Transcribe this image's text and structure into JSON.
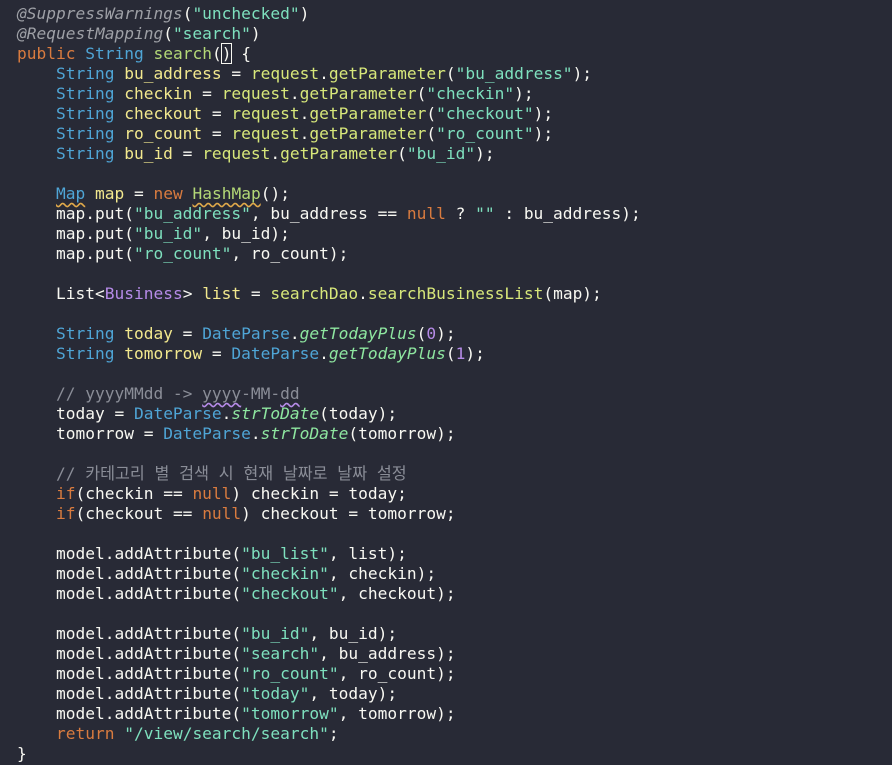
{
  "editor": {
    "lines": [
      [
        {
          "t": "@SuppressWarnings",
          "c": "ann"
        },
        {
          "t": "(",
          "c": "plain"
        },
        {
          "t": "\"unchecked\"",
          "c": "str"
        },
        {
          "t": ")",
          "c": "plain"
        }
      ],
      [
        {
          "t": "@RequestMapping",
          "c": "ann"
        },
        {
          "t": "(",
          "c": "plain"
        },
        {
          "t": "\"search\"",
          "c": "str"
        },
        {
          "t": ")",
          "c": "plain"
        }
      ],
      [
        {
          "t": "public ",
          "c": "kw"
        },
        {
          "t": "String ",
          "c": "ty"
        },
        {
          "t": "search",
          "c": "cls"
        },
        {
          "t": "(",
          "c": "plain"
        },
        {
          "t": ")",
          "c": "plain caret-box"
        },
        {
          "t": " {",
          "c": "plain"
        }
      ],
      [
        {
          "t": "    String ",
          "c": "ty"
        },
        {
          "t": "bu_address",
          "c": "var"
        },
        {
          "t": " = ",
          "c": "plain"
        },
        {
          "t": "request",
          "c": "obj"
        },
        {
          "t": ".",
          "c": "plain"
        },
        {
          "t": "getParameter",
          "c": "meth"
        },
        {
          "t": "(",
          "c": "plain"
        },
        {
          "t": "\"bu_address\"",
          "c": "str"
        },
        {
          "t": ");",
          "c": "plain"
        }
      ],
      [
        {
          "t": "    String ",
          "c": "ty"
        },
        {
          "t": "checkin",
          "c": "var"
        },
        {
          "t": " = ",
          "c": "plain"
        },
        {
          "t": "request",
          "c": "obj"
        },
        {
          "t": ".",
          "c": "plain"
        },
        {
          "t": "getParameter",
          "c": "meth"
        },
        {
          "t": "(",
          "c": "plain"
        },
        {
          "t": "\"checkin\"",
          "c": "str"
        },
        {
          "t": ");",
          "c": "plain"
        }
      ],
      [
        {
          "t": "    String ",
          "c": "ty"
        },
        {
          "t": "checkout",
          "c": "var"
        },
        {
          "t": " = ",
          "c": "plain"
        },
        {
          "t": "request",
          "c": "obj"
        },
        {
          "t": ".",
          "c": "plain"
        },
        {
          "t": "getParameter",
          "c": "meth"
        },
        {
          "t": "(",
          "c": "plain"
        },
        {
          "t": "\"checkout\"",
          "c": "str"
        },
        {
          "t": ");",
          "c": "plain"
        }
      ],
      [
        {
          "t": "    String ",
          "c": "ty"
        },
        {
          "t": "ro_count",
          "c": "var"
        },
        {
          "t": " = ",
          "c": "plain"
        },
        {
          "t": "request",
          "c": "obj"
        },
        {
          "t": ".",
          "c": "plain"
        },
        {
          "t": "getParameter",
          "c": "meth"
        },
        {
          "t": "(",
          "c": "plain"
        },
        {
          "t": "\"ro_count\"",
          "c": "str"
        },
        {
          "t": ");",
          "c": "plain"
        }
      ],
      [
        {
          "t": "    String ",
          "c": "ty"
        },
        {
          "t": "bu_id",
          "c": "var"
        },
        {
          "t": " = ",
          "c": "plain"
        },
        {
          "t": "request",
          "c": "obj"
        },
        {
          "t": ".",
          "c": "plain"
        },
        {
          "t": "getParameter",
          "c": "meth"
        },
        {
          "t": "(",
          "c": "plain"
        },
        {
          "t": "\"bu_id\"",
          "c": "str"
        },
        {
          "t": ");",
          "c": "plain"
        }
      ],
      [],
      [
        {
          "t": "    ",
          "c": "plain"
        },
        {
          "t": "Map",
          "c": "ty squig"
        },
        {
          "t": " ",
          "c": "plain"
        },
        {
          "t": "map",
          "c": "var"
        },
        {
          "t": " = ",
          "c": "plain"
        },
        {
          "t": "new ",
          "c": "kw"
        },
        {
          "t": "HashMap",
          "c": "cls squig"
        },
        {
          "t": "();",
          "c": "plain"
        }
      ],
      [
        {
          "t": "    map.put(",
          "c": "plain"
        },
        {
          "t": "\"bu_address\"",
          "c": "str"
        },
        {
          "t": ", bu_address == ",
          "c": "plain"
        },
        {
          "t": "null",
          "c": "kw"
        },
        {
          "t": " ? ",
          "c": "plain"
        },
        {
          "t": "\"\"",
          "c": "str"
        },
        {
          "t": " : bu_address);",
          "c": "plain"
        }
      ],
      [
        {
          "t": "    map.put(",
          "c": "plain"
        },
        {
          "t": "\"bu_id\"",
          "c": "str"
        },
        {
          "t": ", bu_id);",
          "c": "plain"
        }
      ],
      [
        {
          "t": "    map.put(",
          "c": "plain"
        },
        {
          "t": "\"ro_count\"",
          "c": "str"
        },
        {
          "t": ", ro_count);",
          "c": "plain"
        }
      ],
      [],
      [
        {
          "t": "    List<",
          "c": "plain"
        },
        {
          "t": "Business",
          "c": "gen"
        },
        {
          "t": "> ",
          "c": "plain"
        },
        {
          "t": "list",
          "c": "var"
        },
        {
          "t": " = ",
          "c": "plain"
        },
        {
          "t": "searchDao",
          "c": "obj"
        },
        {
          "t": ".",
          "c": "plain"
        },
        {
          "t": "searchBusinessList",
          "c": "meth"
        },
        {
          "t": "(map);",
          "c": "plain"
        }
      ],
      [],
      [
        {
          "t": "    String ",
          "c": "ty"
        },
        {
          "t": "today",
          "c": "var"
        },
        {
          "t": " = ",
          "c": "plain"
        },
        {
          "t": "DateParse",
          "c": "stat"
        },
        {
          "t": ".",
          "c": "plain"
        },
        {
          "t": "getTodayPlus",
          "c": "stmeth"
        },
        {
          "t": "(",
          "c": "plain"
        },
        {
          "t": "0",
          "c": "num"
        },
        {
          "t": ");",
          "c": "plain"
        }
      ],
      [
        {
          "t": "    String ",
          "c": "ty"
        },
        {
          "t": "tomorrow",
          "c": "var"
        },
        {
          "t": " = ",
          "c": "plain"
        },
        {
          "t": "DateParse",
          "c": "stat"
        },
        {
          "t": ".",
          "c": "plain"
        },
        {
          "t": "getTodayPlus",
          "c": "stmeth"
        },
        {
          "t": "(",
          "c": "plain"
        },
        {
          "t": "1",
          "c": "num"
        },
        {
          "t": ");",
          "c": "plain"
        }
      ],
      [],
      [
        {
          "t": "    // yyyyMMdd -> ",
          "c": "cmt"
        },
        {
          "t": "yyyy",
          "c": "cmt squig-purple"
        },
        {
          "t": "-MM-",
          "c": "cmt"
        },
        {
          "t": "dd",
          "c": "cmt squig-purple"
        }
      ],
      [
        {
          "t": "    today = ",
          "c": "plain"
        },
        {
          "t": "DateParse",
          "c": "stat"
        },
        {
          "t": ".",
          "c": "plain"
        },
        {
          "t": "strToDate",
          "c": "stmeth"
        },
        {
          "t": "(today);",
          "c": "plain"
        }
      ],
      [
        {
          "t": "    tomorrow = ",
          "c": "plain"
        },
        {
          "t": "DateParse",
          "c": "stat"
        },
        {
          "t": ".",
          "c": "plain"
        },
        {
          "t": "strToDate",
          "c": "stmeth"
        },
        {
          "t": "(tomorrow);",
          "c": "plain"
        }
      ],
      [],
      [
        {
          "t": "    // 카테고리 별 검색 시 현재 날짜로 날짜 설정",
          "c": "cmt"
        }
      ],
      [
        {
          "t": "    ",
          "c": "plain"
        },
        {
          "t": "if",
          "c": "kw"
        },
        {
          "t": "(checkin == ",
          "c": "plain"
        },
        {
          "t": "null",
          "c": "kw"
        },
        {
          "t": ") checkin = today;",
          "c": "plain"
        }
      ],
      [
        {
          "t": "    ",
          "c": "plain"
        },
        {
          "t": "if",
          "c": "kw"
        },
        {
          "t": "(checkout == ",
          "c": "plain"
        },
        {
          "t": "null",
          "c": "kw"
        },
        {
          "t": ") checkout = tomorrow;",
          "c": "plain"
        }
      ],
      [],
      [
        {
          "t": "    model.addAttribute(",
          "c": "plain"
        },
        {
          "t": "\"bu_list\"",
          "c": "str"
        },
        {
          "t": ", list);",
          "c": "plain"
        }
      ],
      [
        {
          "t": "    model.addAttribute(",
          "c": "plain"
        },
        {
          "t": "\"checkin\"",
          "c": "str"
        },
        {
          "t": ", checkin);",
          "c": "plain"
        }
      ],
      [
        {
          "t": "    model.addAttribute(",
          "c": "plain"
        },
        {
          "t": "\"checkout\"",
          "c": "str"
        },
        {
          "t": ", checkout);",
          "c": "plain"
        }
      ],
      [],
      [
        {
          "t": "    model.addAttribute(",
          "c": "plain"
        },
        {
          "t": "\"bu_id\"",
          "c": "str"
        },
        {
          "t": ", bu_id);",
          "c": "plain"
        }
      ],
      [
        {
          "t": "    model.addAttribute(",
          "c": "plain"
        },
        {
          "t": "\"search\"",
          "c": "str"
        },
        {
          "t": ", bu_address);",
          "c": "plain"
        }
      ],
      [
        {
          "t": "    model.addAttribute(",
          "c": "plain"
        },
        {
          "t": "\"ro_count\"",
          "c": "str"
        },
        {
          "t": ", ro_count);",
          "c": "plain"
        }
      ],
      [
        {
          "t": "    model.addAttribute(",
          "c": "plain"
        },
        {
          "t": "\"today\"",
          "c": "str"
        },
        {
          "t": ", today);",
          "c": "plain"
        }
      ],
      [
        {
          "t": "    model.addAttribute(",
          "c": "plain"
        },
        {
          "t": "\"tomorrow\"",
          "c": "str"
        },
        {
          "t": ", tomorrow);",
          "c": "plain"
        }
      ],
      [
        {
          "t": "    ",
          "c": "plain"
        },
        {
          "t": "return ",
          "c": "kw"
        },
        {
          "t": "\"/view/search/search\"",
          "c": "str"
        },
        {
          "t": ";",
          "c": "plain"
        }
      ],
      [
        {
          "t": "}",
          "c": "plain"
        }
      ]
    ]
  },
  "colors": {
    "background": "#282A36",
    "string": "#7EE0BE",
    "keyword": "#D97B3F",
    "type": "#4FA5D6",
    "comment": "#8A8D97"
  }
}
